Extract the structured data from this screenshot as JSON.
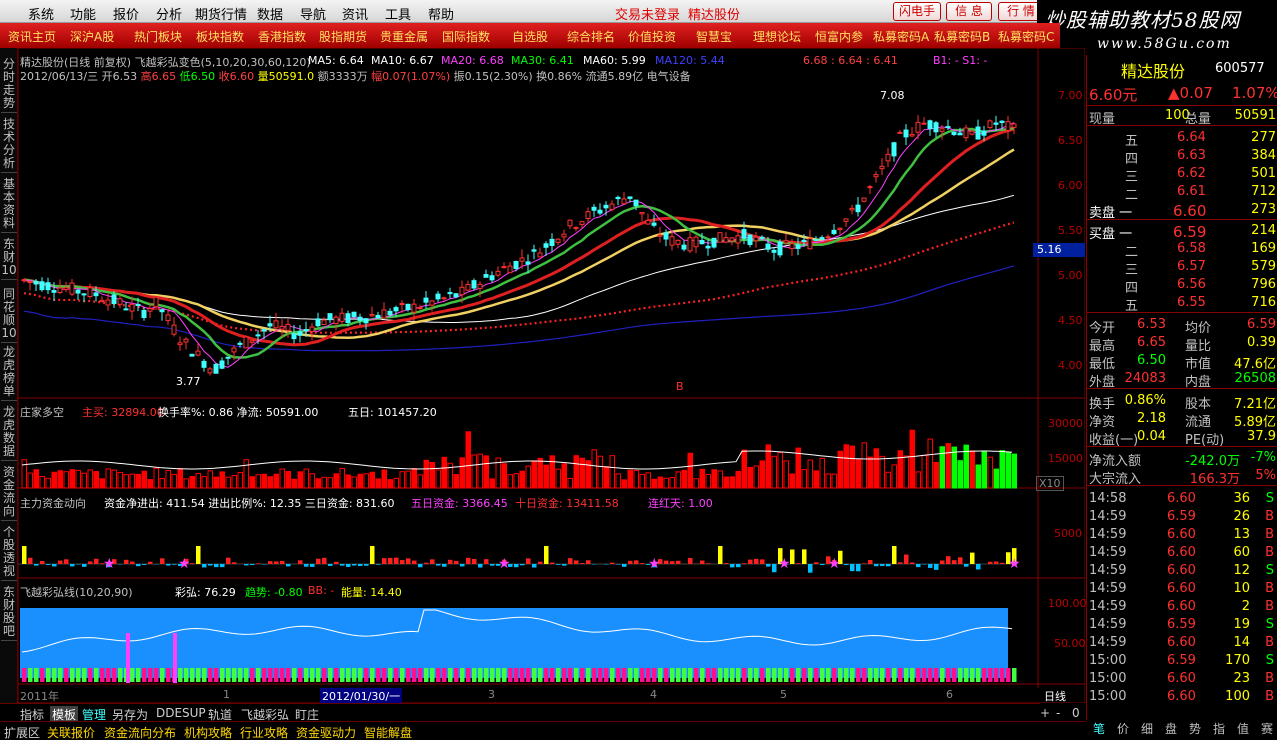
{
  "menu": {
    "items": [
      "系统",
      "功能",
      "报价",
      "分析",
      "期货行情",
      "数据",
      "导航",
      "资讯",
      "工具",
      "帮助"
    ],
    "notice1": "交易未登录",
    "notice2": "精达股份",
    "buttons": [
      "闪电手",
      "信 息",
      "行 情"
    ]
  },
  "watermark": {
    "line1": "炒股辅助教材58股网",
    "line2": "www.58Gu.com"
  },
  "navbar": [
    "资讯主页",
    "深沪A股",
    "热门板块",
    "板块指数",
    "香港指数",
    "股指期货",
    "贵重金属",
    "国际指数",
    "自选股",
    "综合排名",
    "价值投资",
    "智慧宝",
    "理想论坛",
    "恒富内参",
    "私募密码A",
    "私募密码B",
    "私募密码C"
  ],
  "left_tabs": [
    "分时走势",
    "技术分析",
    "基本资料",
    "东财10",
    "同花顺10",
    "龙虎榜单",
    "龙虎数据",
    "资金流向",
    "个股透视",
    "东财股吧"
  ],
  "chart": {
    "header_name": "精达股份(日线 前复权) 飞越彩弘变色(5,10,20,30,60,120)",
    "ma5": "MA5: 6.64",
    "ma10": "MA10: 6.67",
    "ma20": "MA20: 6.68",
    "ma30": "MA30: 6.41",
    "ma60": "MA60: 5.99",
    "ma120": "MA120: 5.44",
    "header_right": "6.68 : 6.64 : 6.41",
    "b1": "B1: -  S1: -",
    "info_date": "2012/06/13/三",
    "info_open": "开6.53",
    "info_high": "高6.65",
    "info_low": "低6.50",
    "info_close": "收6.60",
    "info_vol": "量50591.0",
    "info_amt": "额3333万",
    "info_chg": "幅0.07(1.07%)",
    "info_rest": "振0.15(2.30%) 换0.86% 流通5.89亿 电气设备",
    "high_label": "7.08",
    "low_label": "3.77",
    "cur_label": "5.16",
    "y_ticks": [
      "7.00",
      "6.50",
      "6.00",
      "5.50",
      "5.00",
      "4.50",
      "4.00"
    ],
    "b_mark": "B",
    "panel2_title": "庄家多空",
    "panel2_main": "主买: 32894.00",
    "panel2_rest": "换手率%: 0.86  净流: 50591.00",
    "panel2_5d": "五日: 101457.20",
    "panel2_y": [
      "30000",
      "15000"
    ],
    "panel2_x10": "X10",
    "panel3_title": "主力资金动向",
    "panel3_net": "资金净进出: 411.54  进出比例%: 12.35  三日资金: 831.60",
    "panel3_5d": "五日资金: 3366.45",
    "panel3_10d": "十日资金: 13411.58",
    "panel3_lian": "连红天: 1.00",
    "panel3_y": "5000",
    "panel4_title": "飞越彩弘线(10,20,90)",
    "panel4_caihong": "彩弘: 76.29",
    "panel4_trend": "趋势: -0.80",
    "panel4_bb": "BB: -",
    "panel4_energy": "能量: 14.40",
    "panel4_y": [
      "100.00",
      "50.00"
    ],
    "x_labels": [
      "2011年",
      "1",
      "2012/01/30/一",
      "3",
      "4",
      "5",
      "6"
    ],
    "period": "日线"
  },
  "right_panel": {
    "name": "精达股份",
    "code": "600577",
    "price": "6.60元",
    "change": "▲0.07",
    "pct": "1.07%",
    "now_label": "现量",
    "now_val": "100",
    "total_label": "总量",
    "total_val": "50591",
    "sells": [
      {
        "label": "五",
        "price": "6.64",
        "vol": "277"
      },
      {
        "label": "四",
        "price": "6.63",
        "vol": "384"
      },
      {
        "label": "三",
        "price": "6.62",
        "vol": "501"
      },
      {
        "label": "二",
        "price": "6.61",
        "vol": "712"
      },
      {
        "label": "卖盘 一",
        "price": "6.60",
        "vol": "273"
      }
    ],
    "buys": [
      {
        "label": "买盘 一",
        "price": "6.59",
        "vol": "214"
      },
      {
        "label": "二",
        "price": "6.58",
        "vol": "169"
      },
      {
        "label": "三",
        "price": "6.57",
        "vol": "579"
      },
      {
        "label": "四",
        "price": "6.56",
        "vol": "796"
      },
      {
        "label": "五",
        "price": "6.55",
        "vol": "716"
      }
    ],
    "stats": [
      {
        "l1": "今开",
        "v1": "6.53",
        "l2": "均价",
        "v2": "6.59"
      },
      {
        "l1": "最高",
        "v1": "6.65",
        "l2": "量比",
        "v2": "0.39"
      },
      {
        "l1": "最低",
        "v1": "6.50",
        "l2": "市值",
        "v2": "47.6亿"
      },
      {
        "l1": "外盘",
        "v1": "24083",
        "l2": "内盘",
        "v2": "26508"
      }
    ],
    "stats2": [
      {
        "l1": "换手",
        "v1": "0.86%",
        "l2": "股本",
        "v2": "7.21亿"
      },
      {
        "l1": "净资",
        "v1": "2.18",
        "l2": "流通",
        "v2": "5.89亿"
      },
      {
        "l1": "收益(一)",
        "v1": "0.04",
        "l2": "PE(动)",
        "v2": "37.9"
      }
    ],
    "flow": [
      {
        "label": "净流入额",
        "val": "-242.0万",
        "pct": "-7%"
      },
      {
        "label": "大宗流入",
        "val": "166.3万",
        "pct": "5%"
      }
    ],
    "ticks": [
      {
        "t": "14:58",
        "p": "6.60",
        "v": "36",
        "s": "S"
      },
      {
        "t": "14:59",
        "p": "6.59",
        "v": "26",
        "s": "B"
      },
      {
        "t": "14:59",
        "p": "6.60",
        "v": "13",
        "s": "B"
      },
      {
        "t": "14:59",
        "p": "6.60",
        "v": "60",
        "s": "B"
      },
      {
        "t": "14:59",
        "p": "6.60",
        "v": "12",
        "s": "S"
      },
      {
        "t": "14:59",
        "p": "6.60",
        "v": "10",
        "s": "B"
      },
      {
        "t": "14:59",
        "p": "6.60",
        "v": "2",
        "s": "B"
      },
      {
        "t": "14:59",
        "p": "6.59",
        "v": "19",
        "s": "S"
      },
      {
        "t": "14:59",
        "p": "6.60",
        "v": "14",
        "s": "B"
      },
      {
        "t": "15:00",
        "p": "6.59",
        "v": "170",
        "s": "S"
      },
      {
        "t": "15:00",
        "p": "6.60",
        "v": "23",
        "s": "B"
      },
      {
        "t": "15:00",
        "p": "6.60",
        "v": "100",
        "s": "B"
      }
    ],
    "bottom_tabs": [
      "笔",
      "价",
      "细",
      "盘",
      "势",
      "指",
      "值",
      "赛"
    ]
  },
  "bottom1": [
    "指标",
    "模板",
    "管理",
    "另存为",
    "DDE",
    "SUP",
    "轨道",
    "飞越彩弘",
    "盯庄"
  ],
  "bottom2": [
    "扩展区",
    "关联报价",
    "资金流向分布",
    "机构攻略",
    "行业攻略",
    "资金驱动力",
    "智能解盘"
  ],
  "zoom": [
    "+",
    "-",
    "0"
  ]
}
